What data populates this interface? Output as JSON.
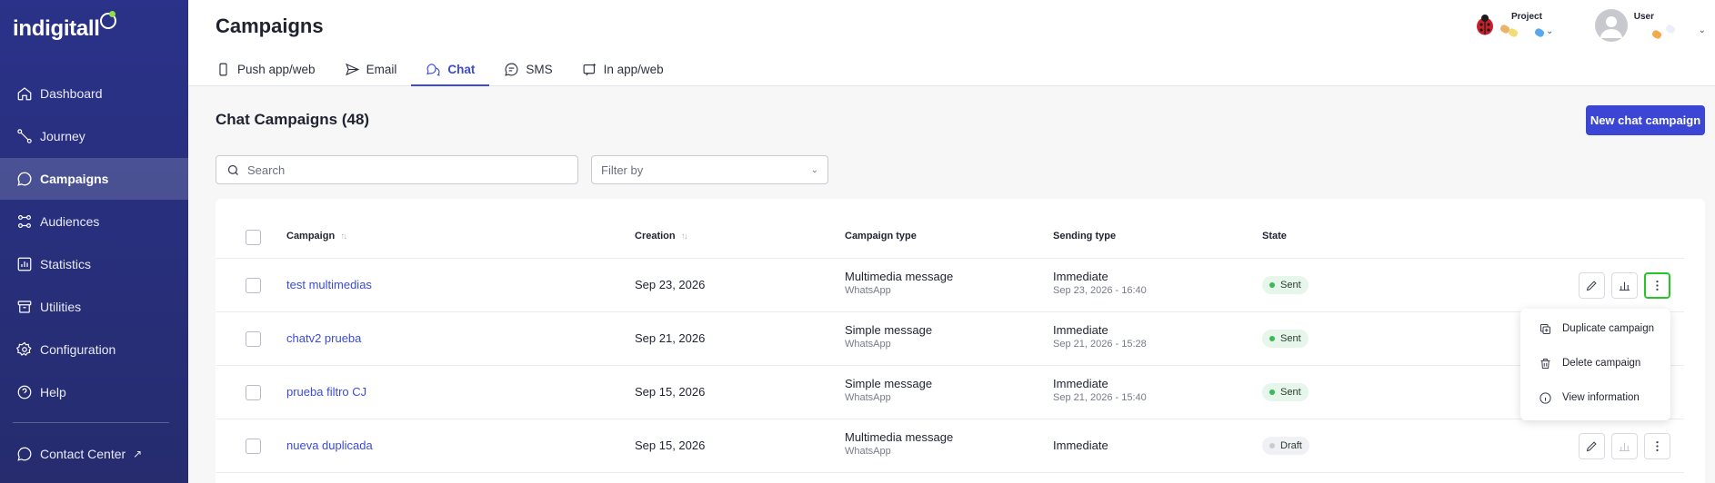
{
  "brand": {
    "logo_text": "indigitall",
    "accent": "#3b47d4",
    "sidebar_bg": "#2a3289"
  },
  "sidebar": {
    "items": [
      {
        "label": "Dashboard",
        "icon": "home-icon"
      },
      {
        "label": "Journey",
        "icon": "journey-icon"
      },
      {
        "label": "Campaigns",
        "icon": "chat-bubble-icon"
      },
      {
        "label": "Audiences",
        "icon": "audience-icon"
      },
      {
        "label": "Statistics",
        "icon": "chart-icon"
      },
      {
        "label": "Utilities",
        "icon": "box-icon"
      },
      {
        "label": "Configuration",
        "icon": "gear-icon"
      },
      {
        "label": "Help",
        "icon": "help-icon"
      }
    ],
    "contact_center": "Contact Center"
  },
  "header": {
    "title": "Campaigns",
    "tabs": [
      "Push app/web",
      "Email",
      "Chat",
      "SMS",
      "In app/web"
    ],
    "project_label": "Project",
    "user_label": "User"
  },
  "main": {
    "title": "Chat Campaigns (48)",
    "new_button": "New chat campaign",
    "search_placeholder": "Search",
    "filter_placeholder": "Filter by",
    "columns": [
      "Campaign",
      "Creation",
      "Campaign type",
      "Sending type",
      "State"
    ],
    "rows": [
      {
        "campaign": "test multimedias",
        "creation": "Sep 23, 2026",
        "type": "Multimedia message",
        "channel": "WhatsApp",
        "sending": "Immediate",
        "sent_at": "Sep 23, 2026 - 16:40",
        "state": "Sent"
      },
      {
        "campaign": "chatv2 prueba",
        "creation": "Sep 21, 2026",
        "type": "Simple message",
        "channel": "WhatsApp",
        "sending": "Immediate",
        "sent_at": "Sep 21, 2026 - 15:28",
        "state": "Sent"
      },
      {
        "campaign": "prueba filtro CJ",
        "creation": "Sep 15, 2026",
        "type": "Simple message",
        "channel": "WhatsApp",
        "sending": "Immediate",
        "sent_at": "Sep 21, 2026 - 15:40",
        "state": "Sent"
      },
      {
        "campaign": "nueva duplicada",
        "creation": "Sep 15, 2026",
        "type": "Multimedia message",
        "channel": "WhatsApp",
        "sending": "Immediate",
        "sent_at": "",
        "state": "Draft"
      }
    ]
  },
  "context_menu": {
    "items": [
      "Duplicate campaign",
      "Delete campaign",
      "View information"
    ]
  }
}
